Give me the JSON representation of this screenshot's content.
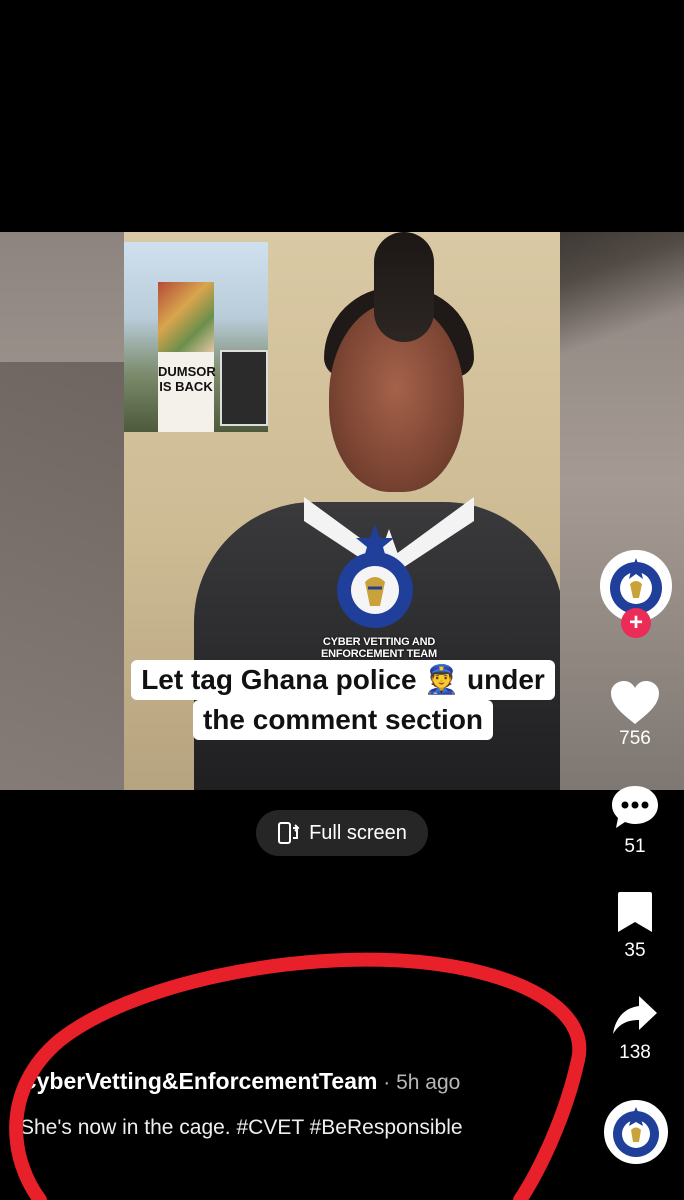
{
  "video": {
    "inset_sign_text": "DUMSOR IS BACK",
    "badge_text": "GHANA POLICE",
    "badge_motto": "SERVICE WITH INTEGRITY",
    "badge_caption": "CYBER VETTING AND ENFORCEMENT TEAM",
    "caption_line1": "Let tag Ghana police 👮 under",
    "caption_line2": "the comment section"
  },
  "fullscreen_button": {
    "label": "Full screen"
  },
  "actions": {
    "likes": "756",
    "comments": "51",
    "saves": "35",
    "shares": "138"
  },
  "follow_button": {
    "label": "+"
  },
  "post": {
    "author": "CyberVetting&EnforcementTeam",
    "separator": " · ",
    "time": "5h ago",
    "text": "She's now in the cage. #CVET #BeResponsible"
  },
  "colors": {
    "like_heart": "#ffffff",
    "follow_plus": "#ea2c56",
    "annotation": "#e8202a",
    "badge_blue": "#1f3f9a"
  }
}
